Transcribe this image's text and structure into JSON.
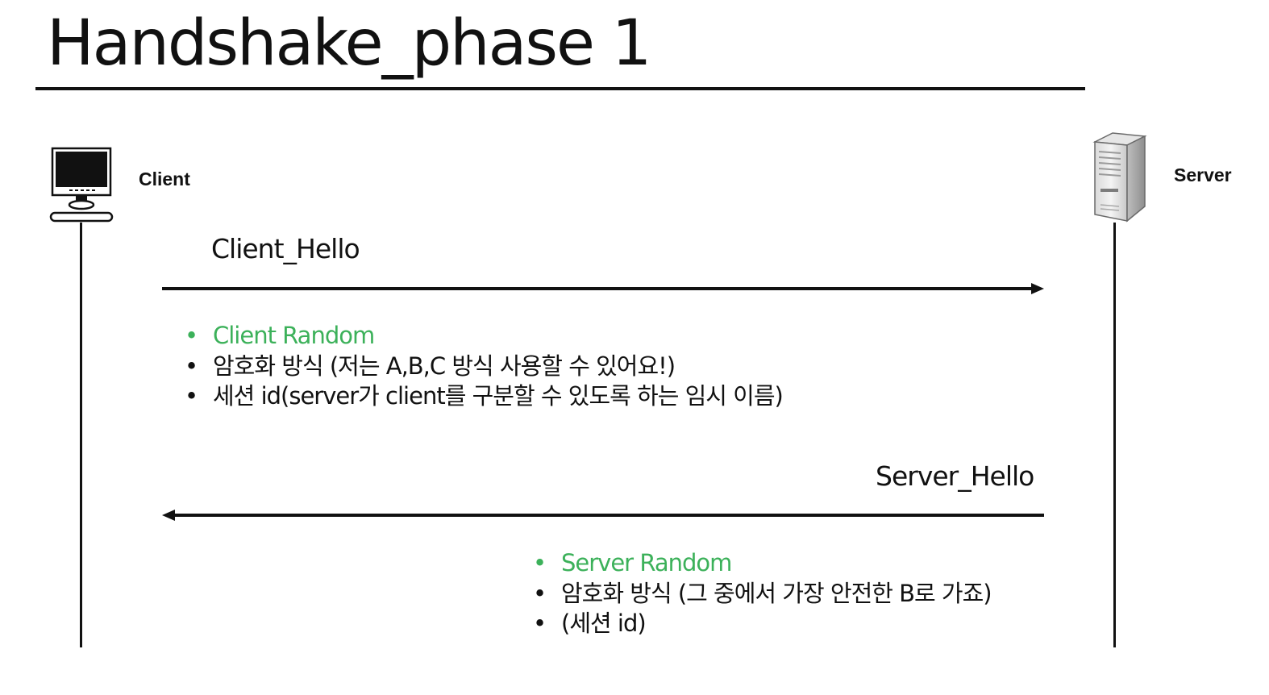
{
  "title": "Handshake_phase 1",
  "actors": {
    "client": {
      "label": "Client",
      "icon": "computer-icon"
    },
    "server": {
      "label": "Server",
      "icon": "server-icon"
    }
  },
  "messages": {
    "client_hello": {
      "label": "Client_Hello",
      "direction": "client-to-server",
      "items": [
        {
          "text": "Client Random",
          "highlight": true
        },
        {
          "text": "암호화 방식 (저는 A,B,C 방식 사용할 수 있어요!)",
          "highlight": false
        },
        {
          "text": "세션 id(server가 client를 구분할 수 있도록 하는 임시 이름)",
          "highlight": false
        }
      ]
    },
    "server_hello": {
      "label": "Server_Hello",
      "direction": "server-to-client",
      "items": [
        {
          "text": "Server Random",
          "highlight": true
        },
        {
          "text": "암호화 방식 (그 중에서 가장 안전한 B로 가죠)",
          "highlight": false
        },
        {
          "text": "(세션 id)",
          "highlight": false
        }
      ]
    }
  },
  "colors": {
    "text": "#111111",
    "highlight": "#3cb15a",
    "line": "#111111"
  }
}
